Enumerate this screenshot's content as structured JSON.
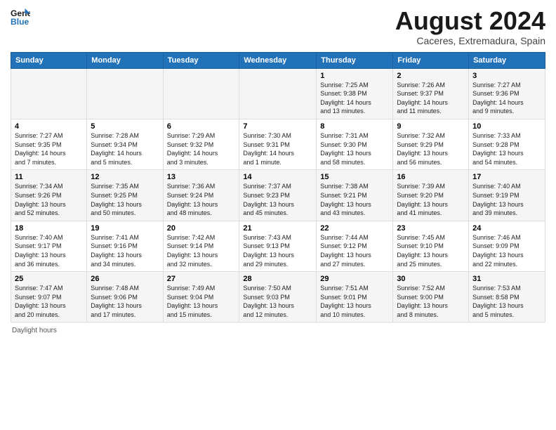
{
  "logo": {
    "line1": "General",
    "line2": "Blue"
  },
  "title": "August 2024",
  "subtitle": "Caceres, Extremadura, Spain",
  "days_of_week": [
    "Sunday",
    "Monday",
    "Tuesday",
    "Wednesday",
    "Thursday",
    "Friday",
    "Saturday"
  ],
  "weeks": [
    [
      {
        "day": "",
        "info": ""
      },
      {
        "day": "",
        "info": ""
      },
      {
        "day": "",
        "info": ""
      },
      {
        "day": "",
        "info": ""
      },
      {
        "day": "1",
        "info": "Sunrise: 7:25 AM\nSunset: 9:38 PM\nDaylight: 14 hours\nand 13 minutes."
      },
      {
        "day": "2",
        "info": "Sunrise: 7:26 AM\nSunset: 9:37 PM\nDaylight: 14 hours\nand 11 minutes."
      },
      {
        "day": "3",
        "info": "Sunrise: 7:27 AM\nSunset: 9:36 PM\nDaylight: 14 hours\nand 9 minutes."
      }
    ],
    [
      {
        "day": "4",
        "info": "Sunrise: 7:27 AM\nSunset: 9:35 PM\nDaylight: 14 hours\nand 7 minutes."
      },
      {
        "day": "5",
        "info": "Sunrise: 7:28 AM\nSunset: 9:34 PM\nDaylight: 14 hours\nand 5 minutes."
      },
      {
        "day": "6",
        "info": "Sunrise: 7:29 AM\nSunset: 9:32 PM\nDaylight: 14 hours\nand 3 minutes."
      },
      {
        "day": "7",
        "info": "Sunrise: 7:30 AM\nSunset: 9:31 PM\nDaylight: 14 hours\nand 1 minute."
      },
      {
        "day": "8",
        "info": "Sunrise: 7:31 AM\nSunset: 9:30 PM\nDaylight: 13 hours\nand 58 minutes."
      },
      {
        "day": "9",
        "info": "Sunrise: 7:32 AM\nSunset: 9:29 PM\nDaylight: 13 hours\nand 56 minutes."
      },
      {
        "day": "10",
        "info": "Sunrise: 7:33 AM\nSunset: 9:28 PM\nDaylight: 13 hours\nand 54 minutes."
      }
    ],
    [
      {
        "day": "11",
        "info": "Sunrise: 7:34 AM\nSunset: 9:26 PM\nDaylight: 13 hours\nand 52 minutes."
      },
      {
        "day": "12",
        "info": "Sunrise: 7:35 AM\nSunset: 9:25 PM\nDaylight: 13 hours\nand 50 minutes."
      },
      {
        "day": "13",
        "info": "Sunrise: 7:36 AM\nSunset: 9:24 PM\nDaylight: 13 hours\nand 48 minutes."
      },
      {
        "day": "14",
        "info": "Sunrise: 7:37 AM\nSunset: 9:23 PM\nDaylight: 13 hours\nand 45 minutes."
      },
      {
        "day": "15",
        "info": "Sunrise: 7:38 AM\nSunset: 9:21 PM\nDaylight: 13 hours\nand 43 minutes."
      },
      {
        "day": "16",
        "info": "Sunrise: 7:39 AM\nSunset: 9:20 PM\nDaylight: 13 hours\nand 41 minutes."
      },
      {
        "day": "17",
        "info": "Sunrise: 7:40 AM\nSunset: 9:19 PM\nDaylight: 13 hours\nand 39 minutes."
      }
    ],
    [
      {
        "day": "18",
        "info": "Sunrise: 7:40 AM\nSunset: 9:17 PM\nDaylight: 13 hours\nand 36 minutes."
      },
      {
        "day": "19",
        "info": "Sunrise: 7:41 AM\nSunset: 9:16 PM\nDaylight: 13 hours\nand 34 minutes."
      },
      {
        "day": "20",
        "info": "Sunrise: 7:42 AM\nSunset: 9:14 PM\nDaylight: 13 hours\nand 32 minutes."
      },
      {
        "day": "21",
        "info": "Sunrise: 7:43 AM\nSunset: 9:13 PM\nDaylight: 13 hours\nand 29 minutes."
      },
      {
        "day": "22",
        "info": "Sunrise: 7:44 AM\nSunset: 9:12 PM\nDaylight: 13 hours\nand 27 minutes."
      },
      {
        "day": "23",
        "info": "Sunrise: 7:45 AM\nSunset: 9:10 PM\nDaylight: 13 hours\nand 25 minutes."
      },
      {
        "day": "24",
        "info": "Sunrise: 7:46 AM\nSunset: 9:09 PM\nDaylight: 13 hours\nand 22 minutes."
      }
    ],
    [
      {
        "day": "25",
        "info": "Sunrise: 7:47 AM\nSunset: 9:07 PM\nDaylight: 13 hours\nand 20 minutes."
      },
      {
        "day": "26",
        "info": "Sunrise: 7:48 AM\nSunset: 9:06 PM\nDaylight: 13 hours\nand 17 minutes."
      },
      {
        "day": "27",
        "info": "Sunrise: 7:49 AM\nSunset: 9:04 PM\nDaylight: 13 hours\nand 15 minutes."
      },
      {
        "day": "28",
        "info": "Sunrise: 7:50 AM\nSunset: 9:03 PM\nDaylight: 13 hours\nand 12 minutes."
      },
      {
        "day": "29",
        "info": "Sunrise: 7:51 AM\nSunset: 9:01 PM\nDaylight: 13 hours\nand 10 minutes."
      },
      {
        "day": "30",
        "info": "Sunrise: 7:52 AM\nSunset: 9:00 PM\nDaylight: 13 hours\nand 8 minutes."
      },
      {
        "day": "31",
        "info": "Sunrise: 7:53 AM\nSunset: 8:58 PM\nDaylight: 13 hours\nand 5 minutes."
      }
    ]
  ],
  "footer": {
    "daylight_label": "Daylight hours"
  },
  "colors": {
    "header_bg": "#2272b9",
    "accent": "#2272b9"
  }
}
